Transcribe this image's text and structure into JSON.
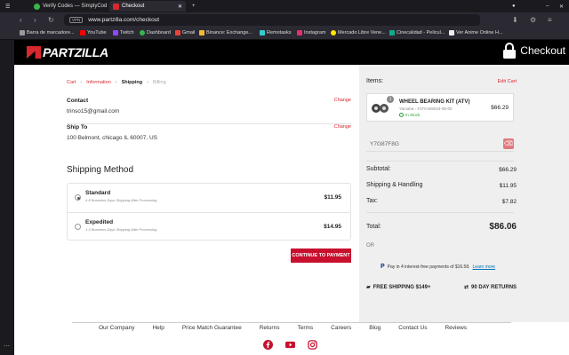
{
  "browser": {
    "tabs": [
      {
        "label": "Verify Codes — SimplyCod"
      },
      {
        "label": "Checkout"
      }
    ],
    "url": "www.partzilla.com/checkout",
    "vpn_label": "VPN",
    "bookmarks": [
      {
        "label": "Barra de marcadore..."
      },
      {
        "label": "YouTube"
      },
      {
        "label": "Twitch"
      },
      {
        "label": "Dashboard"
      },
      {
        "label": "Gmail"
      },
      {
        "label": "Binance: Exchange..."
      },
      {
        "label": "Remotasks"
      },
      {
        "label": "Instagram"
      },
      {
        "label": "Mercado Libre Vene..."
      },
      {
        "label": "Cinecalidad - Pelicul..."
      },
      {
        "label": "Ver Anime Online H..."
      }
    ]
  },
  "header": {
    "logo_text": "PARTZILLA",
    "checkout_label": "Checkout"
  },
  "breadcrumb": {
    "cart": "Cart",
    "information": "Information",
    "shipping": "Shipping",
    "billing": "Billing"
  },
  "contact": {
    "label": "Contact",
    "value": "trinso15@gmail.com",
    "change": "Change"
  },
  "shipto": {
    "label": "Ship To",
    "value": "100 Belmont, chicago IL 60007, US",
    "change": "Change"
  },
  "shipping_method": {
    "title": "Shipping Method",
    "options": [
      {
        "name": "Standard",
        "sub": "4-8 Business Days Shipping After Processing",
        "price": "$11.95"
      },
      {
        "name": "Expedited",
        "sub": "1-3 Business Days Shipping After Processing",
        "price": "$14.95"
      }
    ],
    "continue_label": "CONTINUE TO PAYMENT"
  },
  "summary": {
    "items_label": "Items:",
    "edit_cart": "Edit Cart",
    "item": {
      "qty": "1",
      "name": "WHEEL BEARING KIT (ATV)",
      "sub": "Yamaha - #1T0-W8024-00-00",
      "stock": "In Stock",
      "price": "$66.29"
    },
    "coupon_code": "Y7G87F8G",
    "subtotal_label": "Subtotal:",
    "subtotal": "$66.29",
    "shipping_label": "Shipping & Handling",
    "shipping": "$11.95",
    "tax_label": "Tax:",
    "tax": "$7.82",
    "total_label": "Total:",
    "total": "$86.06",
    "or_label": "OR",
    "paypal_text": "Pay in 4 interest-free payments of $16.58.",
    "paypal_link": "Learn more",
    "free_shipping": "FREE SHIPPING $149+",
    "returns": "90 DAY RETURNS"
  },
  "footer": {
    "links": [
      "Our Company",
      "Help",
      "Price Match Guarantee",
      "Returns",
      "Terms",
      "Careers",
      "Blog",
      "Contact Us",
      "Reviews"
    ]
  },
  "colors": {
    "brand_red": "#d9272e",
    "button_red": "#c8102e",
    "paypal_blue": "#0070ba"
  }
}
